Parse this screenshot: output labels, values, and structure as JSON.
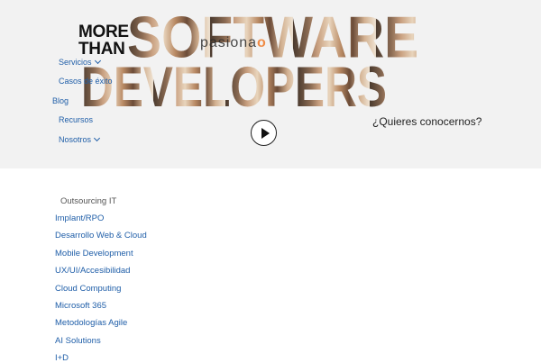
{
  "hero": {
    "more_than": "MORE THAN",
    "word1": "SOFTWARE",
    "word2": "DEVELOPERS",
    "brand": "pasiona",
    "tagline": "¿Quieres conocernos?"
  },
  "nav": {
    "items": [
      {
        "label": "Servicios",
        "has_dropdown": true
      },
      {
        "label": "Casos de éxito",
        "has_dropdown": false
      },
      {
        "label": "Blog",
        "has_dropdown": false
      },
      {
        "label": "Recursos",
        "has_dropdown": false
      },
      {
        "label": "Nosotros",
        "has_dropdown": true
      }
    ]
  },
  "services": {
    "title": "Outsourcing IT",
    "items": [
      "Implant/RPO",
      "Desarrollo Web & Cloud",
      "Mobile Development",
      "UX/UI/Accesibilidad",
      "Cloud Computing",
      "Microsoft 365",
      "Metodologías Agile",
      "AI Solutions",
      "I+D"
    ]
  },
  "colors": {
    "link": "#1f5ea8",
    "hero_bg": "#f2f2f2",
    "brand_accent": "#f07a28"
  },
  "icons": {
    "play": "play-icon",
    "dropdown": "chevron-down-icon"
  }
}
